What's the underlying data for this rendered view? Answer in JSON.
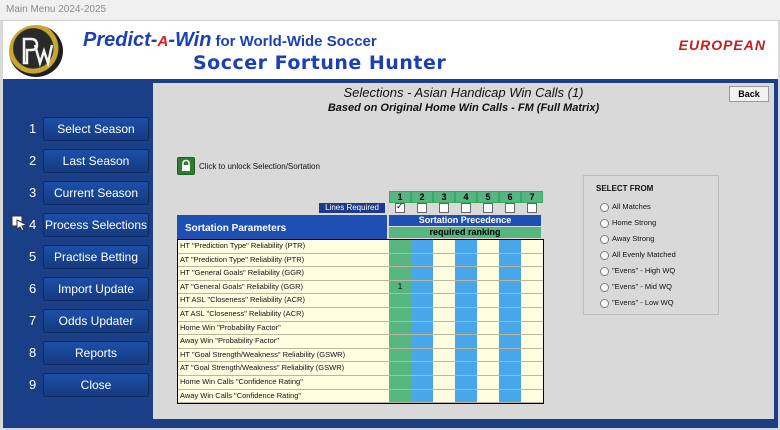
{
  "window": {
    "title": "Main Menu  2024-2025"
  },
  "brand": {
    "main_pre": "Predict-",
    "main_a": "A",
    "main_post": "-Win",
    "main_sub": "for World-Wide Soccer",
    "subtitle": "Soccer Fortune Hunter",
    "edition": "EUROPEAN"
  },
  "nav": {
    "items": [
      {
        "num": "1",
        "label": "Select Season"
      },
      {
        "num": "2",
        "label": "Last Season"
      },
      {
        "num": "3",
        "label": "Current Season"
      },
      {
        "num": "4",
        "label": "Process Selections"
      },
      {
        "num": "5",
        "label": "Practise Betting"
      },
      {
        "num": "6",
        "label": "Import Update"
      },
      {
        "num": "7",
        "label": "Odds Updater"
      },
      {
        "num": "8",
        "label": "Reports"
      },
      {
        "num": "9",
        "label": "Close"
      }
    ]
  },
  "page": {
    "title": "Selections - Asian Handicap Win Calls (1)",
    "subtitle": "Based on Original Home Win Calls - FM (Full Matrix)",
    "back": "Back"
  },
  "lock": {
    "text": "Click to unlock Selection/Sortation",
    "icon": "lock-icon"
  },
  "grid": {
    "columns": [
      "1",
      "2",
      "3",
      "4",
      "5",
      "6",
      "7"
    ],
    "checked": [
      true,
      false,
      false,
      false,
      false,
      false,
      false
    ],
    "lines_required": "Lines Required",
    "sortation_params": "Sortation Parameters",
    "sortation_precedence": "Sortation Precedence",
    "required_ranking": "required ranking",
    "rows": [
      {
        "label": "HT \"Prediction Type\" Reliability (PTR)",
        "rank": ""
      },
      {
        "label": "AT \"Prediction Type\" Reliability (PTR)",
        "rank": ""
      },
      {
        "label": "HT \"General Goals\" Reliability (GGR)",
        "rank": ""
      },
      {
        "label": "AT \"General Goals\" Reliability (GGR)",
        "rank": "1"
      },
      {
        "label": "HT ASL \"Closeness\" Reliability (ACR)",
        "rank": ""
      },
      {
        "label": "AT ASL \"Closeness\" Reliability (ACR)",
        "rank": ""
      },
      {
        "label": "Home Win \"Probability Factor\"",
        "rank": ""
      },
      {
        "label": "Away Win \"Probability Factor\"",
        "rank": ""
      },
      {
        "label": "HT \"Goal Strength/Weakness\" Reliability (GSWR)",
        "rank": ""
      },
      {
        "label": "AT \"Goal Strength/Weakness\" Reliability (GSWR)",
        "rank": ""
      },
      {
        "label": "Home Win Calls \"Confidence Rating\"",
        "rank": ""
      },
      {
        "label": "Away Win Calls \"Confidence Rating\"",
        "rank": ""
      }
    ]
  },
  "select_from": {
    "title": "SELECT FROM",
    "options": [
      "All Matches",
      "Home Strong",
      "Away Strong",
      "All Evenly Matched",
      "\"Evens\" - High WQ",
      "\"Evens\" - Mid WQ",
      "\"Evens\" - Low WQ"
    ]
  },
  "colors": {
    "frame": "#1a3f86",
    "nav_button": "#1d4fa8",
    "green": "#57b57f",
    "blue": "#47a7ea",
    "cream": "#fffde0"
  }
}
